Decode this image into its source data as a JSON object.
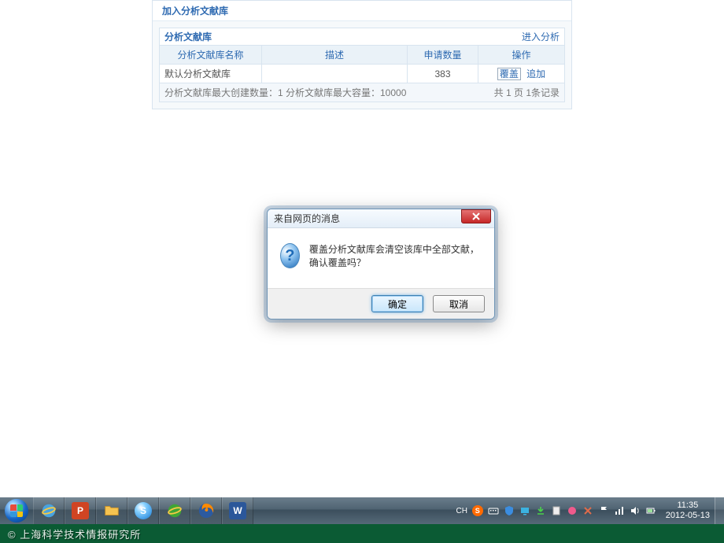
{
  "panel": {
    "title": "加入分析文献库",
    "subtitle": "分析文献库",
    "enter_link": "进入分析",
    "columns": {
      "name": "分析文献库名称",
      "desc": "描述",
      "count": "申请数量",
      "ops": "操作"
    },
    "row": {
      "name": "默认分析文献库",
      "desc": "",
      "count": "383",
      "op_cover": "覆盖",
      "op_append": "追加"
    },
    "footer_left": "分析文献库最大创建数量：1 分析文献库最大容量：10000",
    "footer_right": "共 1 页 1条记录"
  },
  "dialog": {
    "title": "来自网页的消息",
    "message": "覆盖分析文献库会清空该库中全部文献，确认覆盖吗？",
    "ok": "确定",
    "cancel": "取消"
  },
  "taskbar": {
    "ime": "CH",
    "time": "11:35",
    "date": "2012-05-13"
  },
  "footer": "© 上海科学技术情报研究所"
}
